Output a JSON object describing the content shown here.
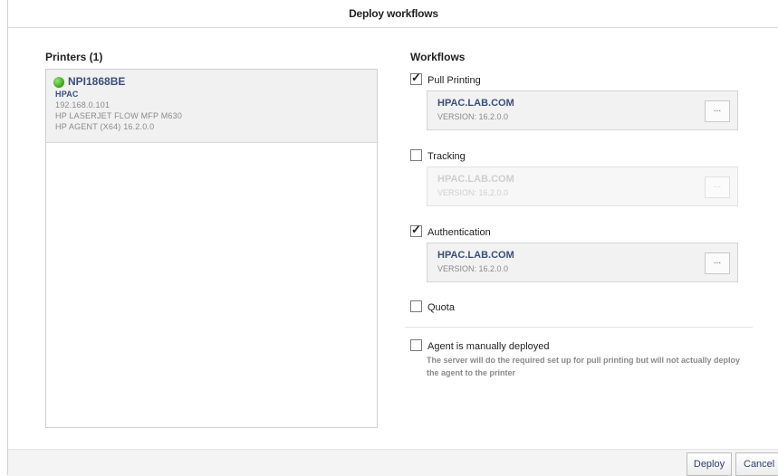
{
  "dialog": {
    "title": "Deploy workflows"
  },
  "printers": {
    "title": "Printers (1)",
    "items": [
      {
        "name": "NPI1868BE",
        "group": "HPAC",
        "ip": "192.168.0.101",
        "model": "HP LASERJET FLOW MFP M630",
        "agent": "HP AGENT (X64) 16.2.0.0",
        "status_color": "#39a81a"
      }
    ]
  },
  "workflows": {
    "title": "Workflows",
    "items": [
      {
        "label": "Pull Printing",
        "checked": true,
        "server": "HPAC.LAB.COM",
        "version": "VERSION: 16.2.0.0",
        "more": "...",
        "enabled": true
      },
      {
        "label": "Tracking",
        "checked": false,
        "server": "HPAC.LAB.COM",
        "version": "VERSION: 16.2.0.0",
        "more": "...",
        "enabled": false
      },
      {
        "label": "Authentication",
        "checked": true,
        "server": "HPAC.LAB.COM",
        "version": "VERSION: 16.2.0.0",
        "more": "...",
        "enabled": true
      },
      {
        "label": "Quota",
        "checked": false
      }
    ],
    "manual": {
      "label": "Agent is manually deployed",
      "checked": false,
      "description": "The server will do the required set up for pull printing but will not actually deploy the agent to the printer"
    }
  },
  "footer": {
    "deploy_label": "Deploy",
    "cancel_label": "Cancel"
  }
}
